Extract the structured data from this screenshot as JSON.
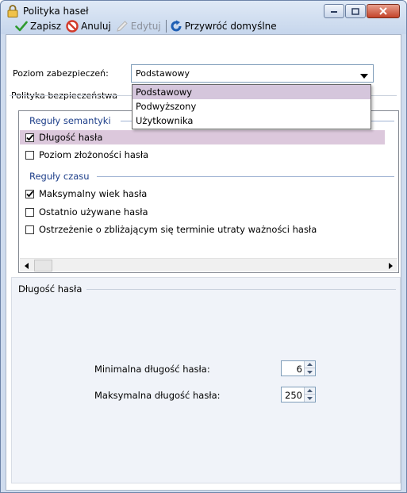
{
  "window": {
    "title": "Polityka haseł",
    "accent_color": "#1e3f8a",
    "title_icon": "lock-icon"
  },
  "toolbar": {
    "save_label": "Zapisz",
    "cancel_label": "Anuluj",
    "edit_label": "Edytuj",
    "restore_label": "Przywróć domyślne"
  },
  "security": {
    "level_label": "Poziom zabezpieczeń:",
    "selected": "Podstawowy",
    "options": [
      "Podstawowy",
      "Podwyższony",
      "Użytkownika"
    ]
  },
  "policy": {
    "label": "Polityka bezpieczeństwa"
  },
  "rules": {
    "groups": [
      {
        "header": "Reguły semantyki",
        "items": [
          {
            "label": "Długość hasła",
            "checked": true,
            "selected": true
          },
          {
            "label": "Poziom złożoności hasła",
            "checked": false,
            "selected": false
          }
        ]
      },
      {
        "header": "Reguły czasu",
        "items": [
          {
            "label": "Maksymalny wiek hasła",
            "checked": true,
            "selected": false
          },
          {
            "label": "Ostatnio używane hasła",
            "checked": false,
            "selected": false
          },
          {
            "label": "Ostrzeżenie o zbliżającym się terminie utraty ważności hasła",
            "checked": false,
            "selected": false
          }
        ]
      }
    ]
  },
  "details": {
    "title": "Długość hasła",
    "min_label": "Minimalna długość hasła:",
    "min_value": "6",
    "max_label": "Maksymalna długość hasła:",
    "max_value": "250"
  }
}
